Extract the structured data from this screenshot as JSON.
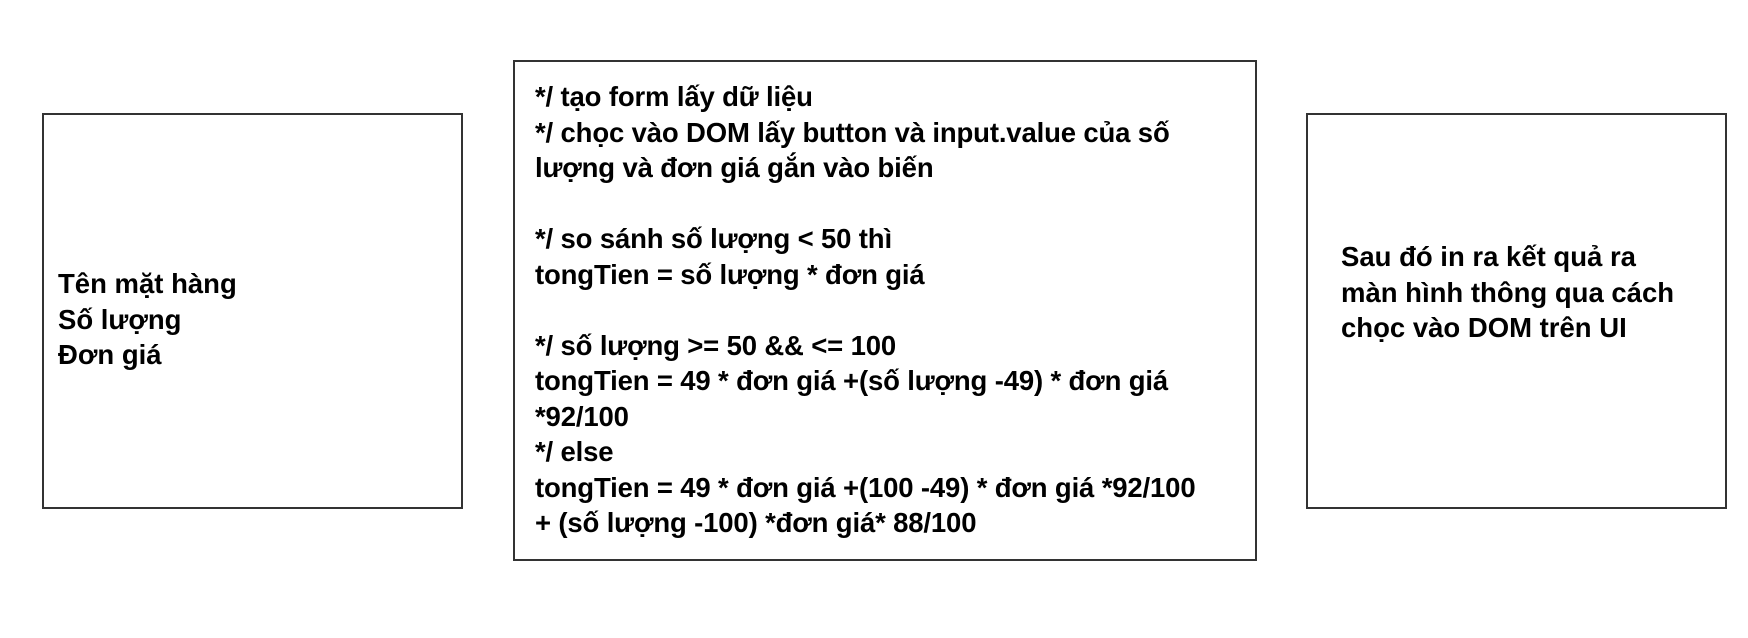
{
  "input_box": {
    "lines": [
      "Tên mặt hàng",
      "Số lượng",
      "Đơn giá"
    ]
  },
  "logic_box": {
    "lines": [
      "*/ tạo form lấy dữ liệu",
      "*/ chọc vào DOM lấy button và input.value của số",
      "lượng và đơn giá gắn vào biến",
      "",
      "*/ so sánh số lượng < 50 thì",
      "tongTien = số lượng * đơn giá",
      "",
      "*/  số lượng >= 50 && <= 100",
      "tongTien = 49 * đơn giá +(số lượng -49) * đơn giá",
      "*92/100",
      "*/  else",
      "tongTien = 49 * đơn giá +(100 -49) * đơn giá *92/100",
      "+ (số lượng -100) *đơn giá* 88/100"
    ]
  },
  "output_box": {
    "lines": [
      "Sau đó in ra kết quả ra",
      "màn hình thông qua cách",
      "chọc vào DOM trên UI"
    ]
  }
}
